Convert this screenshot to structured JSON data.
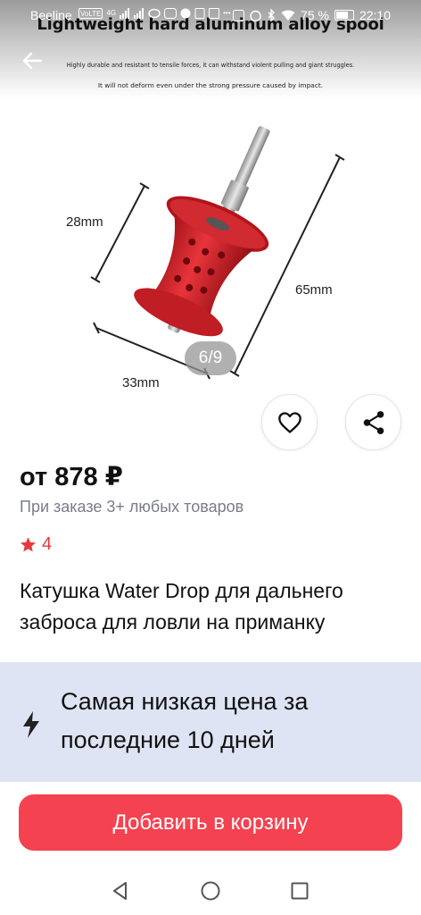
{
  "status_bar": {
    "carrier": "Beeline",
    "network_labels": [
      "VoLTE",
      "4G"
    ],
    "battery": "75 %",
    "battery_fraction": 0.75,
    "time": "22:10"
  },
  "gallery": {
    "promo_title": "Lightweight hard aluminum alloy spool",
    "promo_line_1": "Highly durable and resistant to tensile forces, it can withstand violent pulling and giant struggles.",
    "promo_line_2": "It will not deform even under the strong pressure caused by impact.",
    "dimensions": {
      "height": "28mm",
      "length": "65mm",
      "width": "33mm"
    },
    "counter": "6/9",
    "spool_color": "#d9262e"
  },
  "product": {
    "price": "от 878 ₽",
    "price_note": "При заказе 3+ любых товаров",
    "rating": "4",
    "title": "Катушка Water Drop для дальнего заброса для ловли на приманку"
  },
  "banner": {
    "text": "Самая низкая цена за последние 10 дней",
    "icon": "lightning-icon"
  },
  "cart": {
    "label": "Добавить в корзину",
    "color": "#f44250"
  },
  "colors": {
    "accent": "#f44250",
    "star": "#e8383d",
    "muted_text": "#7a7d8a",
    "banner_bg": "#dee4f3"
  },
  "icons": {
    "back": "arrow-left-icon",
    "favorite": "heart-icon",
    "share": "share-icon",
    "rating": "star-icon",
    "nav": [
      "triangle-back-icon",
      "circle-home-icon",
      "square-recent-icon"
    ]
  }
}
